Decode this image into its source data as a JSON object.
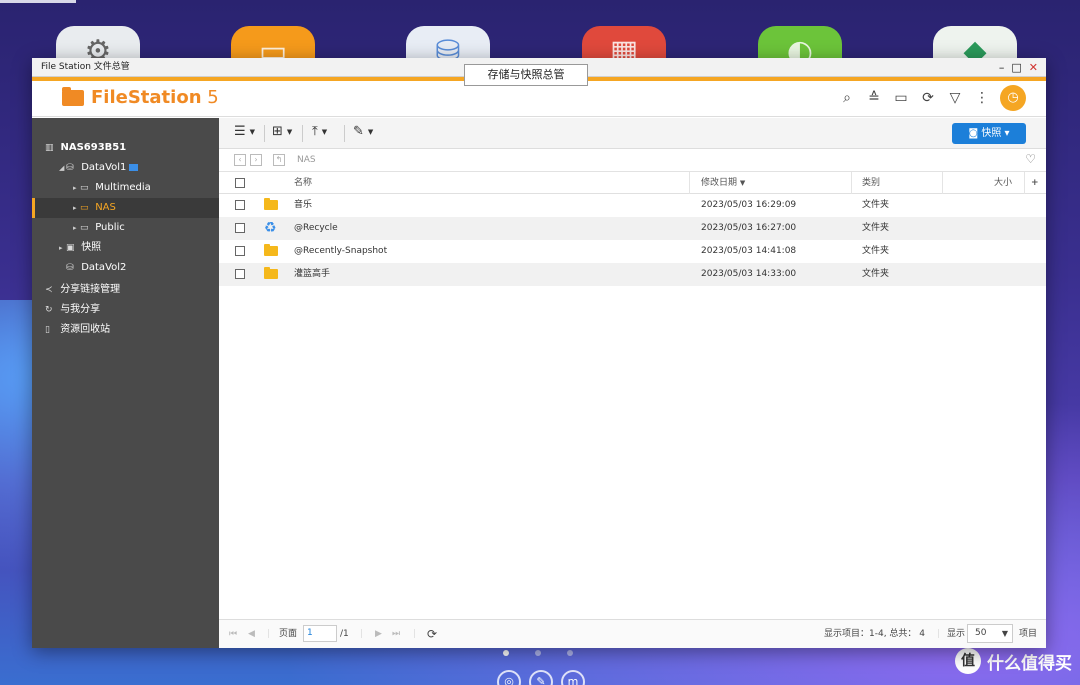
{
  "window": {
    "title": "File Station 文件总管",
    "tooltip": "存储与快照总管",
    "controls": {
      "minimize": "–",
      "maximize": "□",
      "close": "✕"
    }
  },
  "app": {
    "brand_bold": "FileStation",
    "brand_version": " 5",
    "actions": [
      "search-icon",
      "upload-list-icon",
      "media-cast-icon",
      "refresh-icon",
      "filter-icon",
      "more-icon",
      "profile-icon"
    ]
  },
  "sidebar": {
    "server": "NAS693B51",
    "volume1": "DataVol1",
    "folders": [
      "Multimedia",
      "NAS",
      "Public"
    ],
    "snapshot": "快照",
    "volume2": "DataVol2",
    "share_link": "分享链接管理",
    "shared_with_me": "与我分享",
    "recycle_bin": "资源回收站"
  },
  "toolbar": {
    "snapshot_button": "快照"
  },
  "path": {
    "current": "NAS"
  },
  "grid": {
    "headers": {
      "name": "名称",
      "modified": "修改日期",
      "type": "类别",
      "size": "大小"
    },
    "rows": [
      {
        "name": "音乐",
        "modified": "2023/05/03 16:29:09",
        "type": "文件夹",
        "icon": "folder-icon"
      },
      {
        "name": "@Recycle",
        "modified": "2023/05/03 16:27:00",
        "type": "文件夹",
        "icon": "recycle-icon"
      },
      {
        "name": "@Recently-Snapshot",
        "modified": "2023/05/03 14:41:08",
        "type": "文件夹",
        "icon": "folder-icon"
      },
      {
        "name": "灌篮高手",
        "modified": "2023/05/03 14:33:00",
        "type": "文件夹",
        "icon": "folder-icon"
      }
    ]
  },
  "status": {
    "page_label": "页面",
    "page_value": "1",
    "page_total": "/1",
    "items_info": "显示项目：1-4, 总共： 4",
    "show_label": "显示",
    "page_size": "50",
    "items_label": "项目"
  },
  "desktop": {
    "watermark": "什么值得买",
    "watermark_icon": "值"
  }
}
